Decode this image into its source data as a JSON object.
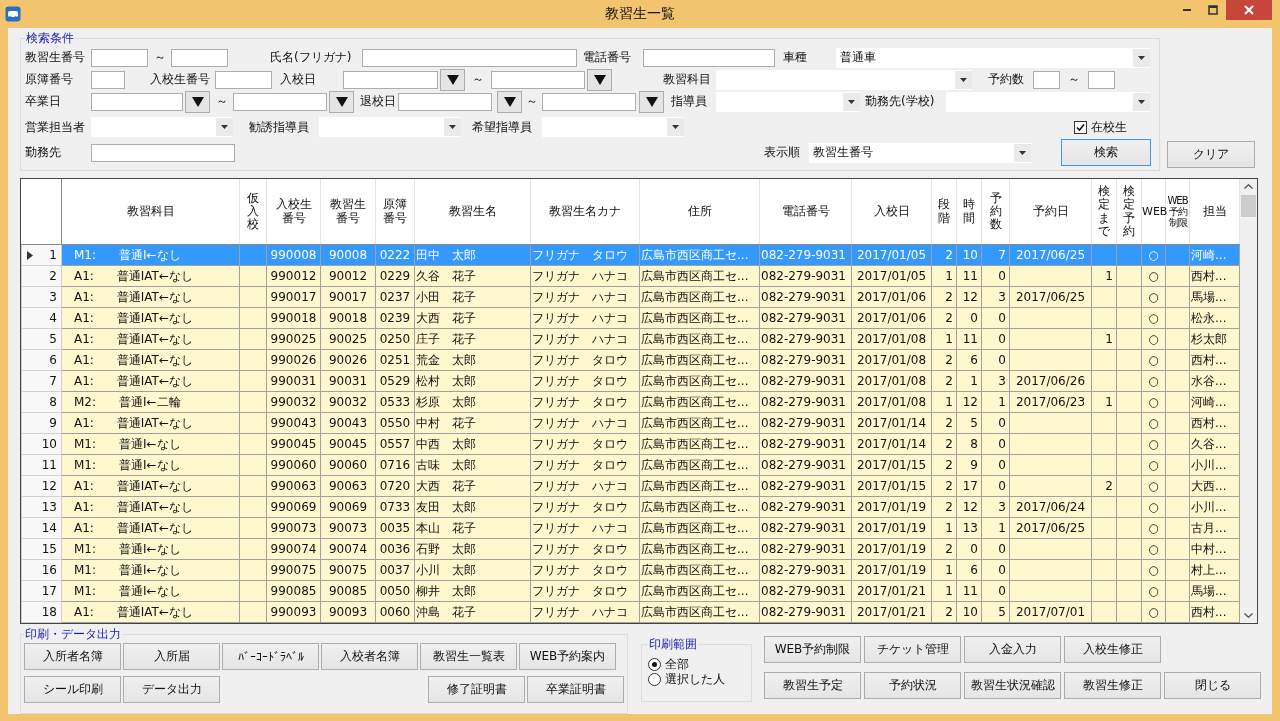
{
  "window": {
    "title": "教習生一覧"
  },
  "search": {
    "title": "検索条件",
    "student_no": {
      "label": "教習生番号",
      "separator": "～"
    },
    "kana_name": {
      "label": "氏名(フリガナ)"
    },
    "phone": {
      "label": "電話番号"
    },
    "vehicle": {
      "label": "車種",
      "value": "普通車"
    },
    "ledger_no": {
      "label": "原簿番号"
    },
    "enroll_no": {
      "label": "入校生番号"
    },
    "enroll_date": {
      "label": "入校日",
      "separator": "～"
    },
    "subject": {
      "label": "教習科目"
    },
    "reservations": {
      "label": "予約数",
      "separator": "～"
    },
    "graduation_date": {
      "label": "卒業日",
      "separator": "～"
    },
    "withdrawal_date": {
      "label": "退校日",
      "separator": "～"
    },
    "instructor": {
      "label": "指導員"
    },
    "workplace_school": {
      "label": "勤務先(学校)"
    },
    "sales_rep": {
      "label": "営業担当者"
    },
    "recruiting_instructor": {
      "label": "勧誘指導員"
    },
    "preferred_instructor": {
      "label": "希望指導員"
    },
    "enrolled": {
      "label": "在校生",
      "checked": true
    },
    "workplace": {
      "label": "勤務先"
    },
    "sort_order": {
      "label": "表示順",
      "value": "教習生番号"
    },
    "search_button": "検索",
    "clear_button": "クリア"
  },
  "table": {
    "columns": [
      "教習科目",
      "仮入校",
      "入校生番号",
      "教習生番号",
      "原簿番号",
      "教習生名",
      "教習生名カナ",
      "住所",
      "電話番号",
      "入校日",
      "段階",
      "時間",
      "予約数",
      "予約日",
      "検定まで",
      "検定予約",
      "WEB",
      "WEB予約制限",
      "担当"
    ],
    "rows": [
      {
        "no": "1",
        "selected": true,
        "cells": [
          "M1:      普通Ⅰ←なし",
          null,
          "990008",
          "90008",
          "0222",
          "田中　太郎",
          "フリガナ　タロウ",
          "広島市西区商工セ...",
          "082-279-9031",
          "2017/01/05",
          "2",
          "10",
          "7",
          "2017/06/25",
          null,
          null,
          "○",
          null,
          "河崎..."
        ]
      },
      {
        "no": "2",
        "selected": false,
        "cells": [
          "A1:      普通ⅠAT←なし",
          null,
          "990012",
          "90012",
          "0229",
          "久谷　花子",
          "フリガナ　ハナコ",
          "広島市西区商工セ...",
          "082-279-9031",
          "2017/01/05",
          "1",
          "11",
          "0",
          null,
          "1",
          null,
          "○",
          null,
          "西村..."
        ]
      },
      {
        "no": "3",
        "selected": false,
        "cells": [
          "A1:      普通ⅠAT←なし",
          null,
          "990017",
          "90017",
          "0237",
          "小田　花子",
          "フリガナ　ハナコ",
          "広島市西区商工セ...",
          "082-279-9031",
          "2017/01/06",
          "2",
          "12",
          "3",
          "2017/06/25",
          null,
          null,
          "○",
          null,
          "馬場..."
        ]
      },
      {
        "no": "4",
        "selected": false,
        "cells": [
          "A1:      普通ⅠAT←なし",
          null,
          "990018",
          "90018",
          "0239",
          "大西　花子",
          "フリガナ　ハナコ",
          "広島市西区商工セ...",
          "082-279-9031",
          "2017/01/06",
          "2",
          "0",
          "0",
          null,
          null,
          null,
          "○",
          null,
          "松永..."
        ]
      },
      {
        "no": "5",
        "selected": false,
        "cells": [
          "A1:      普通ⅠAT←なし",
          null,
          "990025",
          "90025",
          "0250",
          "庄子　花子",
          "フリガナ　ハナコ",
          "広島市西区商工セ...",
          "082-279-9031",
          "2017/01/08",
          "1",
          "11",
          "0",
          null,
          "1",
          null,
          "○",
          null,
          "杉太郎"
        ]
      },
      {
        "no": "6",
        "selected": false,
        "cells": [
          "A1:      普通ⅠAT←なし",
          null,
          "990026",
          "90026",
          "0251",
          "荒金　太郎",
          "フリガナ　タロウ",
          "広島市西区商工セ...",
          "082-279-9031",
          "2017/01/08",
          "2",
          "6",
          "0",
          null,
          null,
          null,
          "○",
          null,
          "西村..."
        ]
      },
      {
        "no": "7",
        "selected": false,
        "cells": [
          "A1:      普通ⅠAT←なし",
          null,
          "990031",
          "90031",
          "0529",
          "松村　太郎",
          "フリガナ　タロウ",
          "広島市西区商工セ...",
          "082-279-9031",
          "2017/01/08",
          "2",
          "1",
          "3",
          "2017/06/26",
          null,
          null,
          "○",
          null,
          "水谷..."
        ]
      },
      {
        "no": "8",
        "selected": false,
        "cells": [
          "M2:      普通Ⅰ←二輪",
          null,
          "990032",
          "90032",
          "0533",
          "杉原　太郎",
          "フリガナ　タロウ",
          "広島市西区商工セ...",
          "082-279-9031",
          "2017/01/08",
          "1",
          "12",
          "1",
          "2017/06/23",
          "1",
          null,
          "○",
          null,
          "河崎..."
        ]
      },
      {
        "no": "9",
        "selected": false,
        "cells": [
          "A1:      普通ⅠAT←なし",
          null,
          "990043",
          "90043",
          "0550",
          "中村　花子",
          "フリガナ　ハナコ",
          "広島市西区商工セ...",
          "082-279-9031",
          "2017/01/14",
          "2",
          "5",
          "0",
          null,
          null,
          null,
          "○",
          null,
          "西村..."
        ]
      },
      {
        "no": "10",
        "selected": false,
        "cells": [
          "M1:      普通Ⅰ←なし",
          null,
          "990045",
          "90045",
          "0557",
          "中西　太郎",
          "フリガナ　タロウ",
          "広島市西区商工セ...",
          "082-279-9031",
          "2017/01/14",
          "2",
          "8",
          "0",
          null,
          null,
          null,
          "○",
          null,
          "久谷..."
        ]
      },
      {
        "no": "11",
        "selected": false,
        "cells": [
          "M1:      普通Ⅰ←なし",
          null,
          "990060",
          "90060",
          "0716",
          "古味　太郎",
          "フリガナ　タロウ",
          "広島市西区商工セ...",
          "082-279-9031",
          "2017/01/15",
          "2",
          "9",
          "0",
          null,
          null,
          null,
          "○",
          null,
          "小川..."
        ]
      },
      {
        "no": "12",
        "selected": false,
        "cells": [
          "A1:      普通ⅠAT←なし",
          null,
          "990063",
          "90063",
          "0720",
          "大西　花子",
          "フリガナ　ハナコ",
          "広島市西区商工セ...",
          "082-279-9031",
          "2017/01/15",
          "2",
          "17",
          "0",
          null,
          "2",
          null,
          "○",
          null,
          "大西..."
        ]
      },
      {
        "no": "13",
        "selected": false,
        "cells": [
          "A1:      普通ⅠAT←なし",
          null,
          "990069",
          "90069",
          "0733",
          "友田　太郎",
          "フリガナ　タロウ",
          "広島市西区商工セ...",
          "082-279-9031",
          "2017/01/19",
          "2",
          "12",
          "3",
          "2017/06/24",
          null,
          null,
          "○",
          null,
          "小川..."
        ]
      },
      {
        "no": "14",
        "selected": false,
        "cells": [
          "A1:      普通ⅠAT←なし",
          null,
          "990073",
          "90073",
          "0035",
          "本山　花子",
          "フリガナ　ハナコ",
          "広島市西区商工セ...",
          "082-279-9031",
          "2017/01/19",
          "1",
          "13",
          "1",
          "2017/06/25",
          null,
          null,
          "○",
          null,
          "古月..."
        ]
      },
      {
        "no": "15",
        "selected": false,
        "cells": [
          "M1:      普通Ⅰ←なし",
          null,
          "990074",
          "90074",
          "0036",
          "石野　太郎",
          "フリガナ　タロウ",
          "広島市西区商工セ...",
          "082-279-9031",
          "2017/01/19",
          "2",
          "0",
          "0",
          null,
          null,
          null,
          "○",
          null,
          "中村..."
        ]
      },
      {
        "no": "16",
        "selected": false,
        "cells": [
          "M1:      普通Ⅰ←なし",
          null,
          "990075",
          "90075",
          "0037",
          "小川　太郎",
          "フリガナ　タロウ",
          "広島市西区商工セ...",
          "082-279-9031",
          "2017/01/19",
          "1",
          "6",
          "0",
          null,
          null,
          null,
          "○",
          null,
          "村上..."
        ]
      },
      {
        "no": "17",
        "selected": false,
        "cells": [
          "M1:      普通Ⅰ←なし",
          null,
          "990085",
          "90085",
          "0050",
          "柳井　太郎",
          "フリガナ　タロウ",
          "広島市西区商工セ...",
          "082-279-9031",
          "2017/01/21",
          "1",
          "11",
          "0",
          null,
          null,
          null,
          "○",
          null,
          "馬場..."
        ]
      },
      {
        "no": "18",
        "selected": false,
        "cells": [
          "A1:      普通ⅠAT←なし",
          null,
          "990093",
          "90093",
          "0060",
          "沖島　花子",
          "フリガナ　ハナコ",
          "広島市西区商工セ...",
          "082-279-9031",
          "2017/01/21",
          "2",
          "10",
          "5",
          "2017/07/01",
          null,
          null,
          "○",
          null,
          "西村..."
        ]
      }
    ]
  },
  "print": {
    "title": "印刷・データ出力",
    "rows": [
      {
        "left": [
          "入所者名簿",
          "入所届",
          "ﾊﾞｰｺｰﾄﾞﾗﾍﾞﾙ",
          "入校者名簿",
          "教習生一覧表",
          "WEB予約案内"
        ]
      },
      {
        "left": [
          "シール印刷",
          "データ出力"
        ],
        "right": [
          "修了証明書",
          "卒業証明書"
        ]
      }
    ]
  },
  "print_range": {
    "title": "印刷範囲",
    "options": [
      {
        "label": "全部",
        "selected": true
      },
      {
        "label": "選択した人",
        "selected": false
      }
    ]
  },
  "actions": [
    [
      "WEB予約制限",
      "チケット管理",
      "入金入力",
      "入校生修正"
    ],
    [
      "教習生予定",
      "予約状況",
      "教習生状況確認",
      "教習生修正",
      "閉じる"
    ]
  ]
}
